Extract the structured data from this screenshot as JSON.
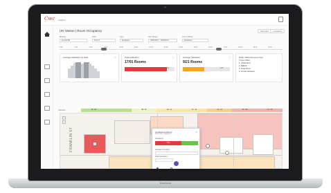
{
  "app": {
    "logo_text": "Cwc",
    "logo_sub": "Insights"
  },
  "header": {
    "title": "UN Vanton | Room Occupancy",
    "right_buttons": [
      "Save View",
      "Occupancy"
    ]
  },
  "filters": [
    {
      "label": "Building",
      "value": "Central Bd"
    },
    {
      "label": "Floor",
      "value": "Floor 3"
    },
    {
      "label": "Type",
      "value": "All Spaces"
    },
    {
      "label": "Date Range",
      "value": "08/06/2017 - 08/09/2017"
    },
    {
      "label": "Time of Week",
      "value": "Weekdays"
    }
  ],
  "timeline": {
    "ticks": [
      "6:00",
      "7:00",
      "8:00",
      "9:00",
      "10:00",
      "11:00",
      "12:00",
      "13:00",
      "14:00",
      "15:00",
      "16:00",
      "17:00",
      "18:00",
      "19:00",
      "20:00"
    ]
  },
  "cards": {
    "avg_util": {
      "title": "Average Utilization by Hour",
      "hist": [
        0.55,
        0.7,
        0.85,
        0.9,
        0.9,
        0.8,
        0.88,
        0.9,
        0.82,
        0.7,
        0.55,
        0.4
      ]
    },
    "peak": {
      "title": "Peak Utilization",
      "value": "17/91 Rooms",
      "fill_fraction": 0.85,
      "fill_color": "#e33b3b",
      "note": "94%"
    },
    "avg": {
      "title": "Average Utilization",
      "value": "9/21 Rooms",
      "fill_fraction": 0.45,
      "fill_color": "#f5a623",
      "note": "43%"
    },
    "types": {
      "title": "Peak Utilized Amount Spa",
      "items": [
        "1 Open Office",
        "1. LOGE ROO",
        "2. BREAK",
        "3. Small Room",
        "4. Private Hardware"
      ]
    }
  },
  "heat_strip": {
    "label": "Utilization",
    "segments": [
      {
        "text": "08 - 08",
        "color": "#b7e08f"
      },
      {
        "text": "",
        "color": "#b7e08f"
      },
      {
        "text": "09 - 10",
        "color": "#eef3c4"
      },
      {
        "text": "10 - 11",
        "color": "#fbe4a8"
      },
      {
        "text": "11 - 12",
        "color": "#fbe4a8"
      },
      {
        "text": "12 - 13",
        "color": "#f8cf8a"
      },
      {
        "text": "13 - 14",
        "color": "#f6b0a8"
      },
      {
        "text": "14 - 15",
        "color": "#f6b0a8"
      }
    ]
  },
  "plan": {
    "street": "FRANKLIN ST"
  },
  "popup": {
    "title": "Conference Room",
    "subtitle": "Room 301 | Capacity 8",
    "occupancy_label": "Occupancy",
    "fill_text": "71%",
    "field1": "Average Occupancy",
    "field2": "Peak Occupancy"
  },
  "device": {
    "label": "MacBook"
  }
}
